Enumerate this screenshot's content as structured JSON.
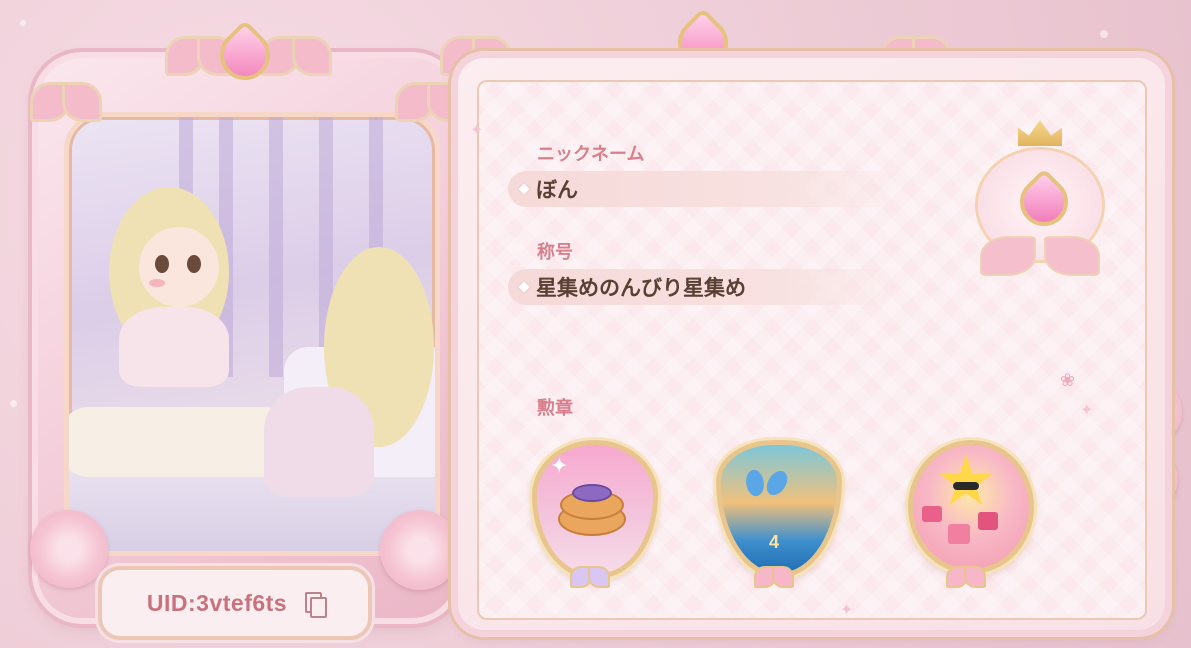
{
  "profile": {
    "uid_text": "UID:3vtef6ts",
    "nickname_label": "ニックネーム",
    "nickname_value": "ぼん",
    "title_label": "称号",
    "title_value": "星集めのんびり星集め",
    "badges_label": "勲章"
  },
  "badges": [
    {
      "theme": "pancake",
      "icon": "pancake-badge-icon"
    },
    {
      "theme": "butterfly",
      "icon": "butterfly-badge-icon",
      "number": "4"
    },
    {
      "theme": "star",
      "icon": "star-sunglasses-badge-icon"
    }
  ],
  "icons": {
    "copy": "copy-icon",
    "heart_gem": "heart-gem-icon",
    "emblem": "heart-crown-emblem-icon"
  },
  "colors": {
    "accent_label": "#d97f8c",
    "uid_text": "#c8727e",
    "value_text": "#5a3f34",
    "frame_pink": "#f4bccb",
    "gold": "#e8c58d"
  }
}
